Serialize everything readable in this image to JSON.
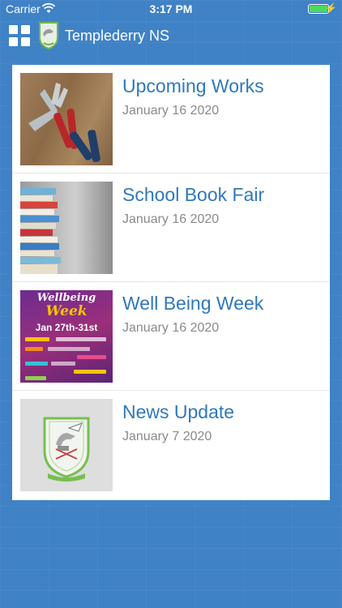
{
  "status_bar": {
    "carrier": "Carrier",
    "time": "3:17 PM",
    "battery_level": 1.0
  },
  "header": {
    "title": "Templederry NS",
    "menu_icon": "grid-icon",
    "logo_icon": "school-crest-icon"
  },
  "news": {
    "items": [
      {
        "title": " Upcoming Works",
        "date": "January 16 2020",
        "image": "tools-photo"
      },
      {
        "title": "School Book Fair",
        "date": "January 16 2020",
        "image": "book-stack-photo"
      },
      {
        "title": "Well Being Week",
        "date": "January 16 2020",
        "image": "wellbeing-week-poster",
        "poster": {
          "line1": "Wellbeing",
          "line2": "Week",
          "dates": "Jan 27th-31st"
        }
      },
      {
        "title": "News Update",
        "date": "January 7 2020",
        "image": "school-crest"
      }
    ]
  },
  "colors": {
    "background": "#3f82c6",
    "title_text": "#2f78bb",
    "date_text": "#8a8a8a"
  }
}
